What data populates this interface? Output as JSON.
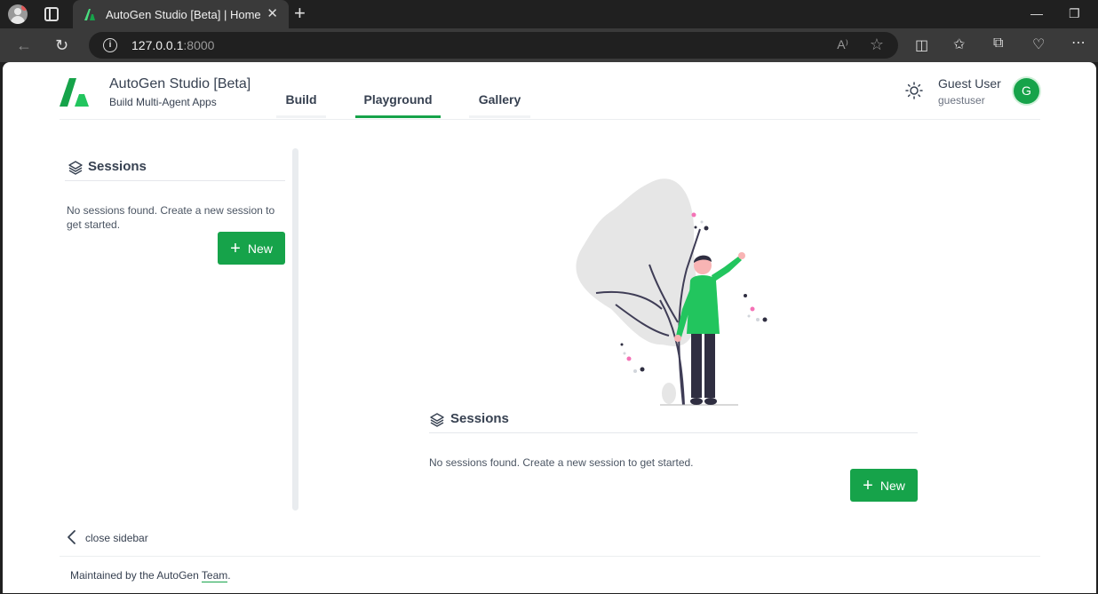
{
  "browser": {
    "tab_title": "AutoGen Studio [Beta] | Home",
    "tab_close": "✕",
    "new_tab": "+",
    "url_host": "127.0.0.1",
    "url_port": ":8000",
    "read_aloud": "A⁾"
  },
  "header": {
    "title": "AutoGen Studio [Beta]",
    "subtitle": "Build Multi-Agent Apps",
    "tabs": [
      {
        "label": "Build"
      },
      {
        "label": "Playground"
      },
      {
        "label": "Gallery"
      }
    ],
    "active_tab": "Playground",
    "user_name": "Guest User",
    "user_id": "guestuser",
    "avatar_initial": "G"
  },
  "sidebar": {
    "heading": "Sessions",
    "empty_message": "No sessions found. Create a new session to get started.",
    "new_button": "New",
    "close_label": "close sidebar"
  },
  "main": {
    "heading": "Sessions",
    "empty_message": "No sessions found. Create a new session to get started.",
    "new_button": "New"
  },
  "footer": {
    "prefix": "Maintained by the AutoGen ",
    "link": "Team",
    "suffix": "."
  },
  "colors": {
    "accent": "#16a34a",
    "text": "#374151"
  }
}
